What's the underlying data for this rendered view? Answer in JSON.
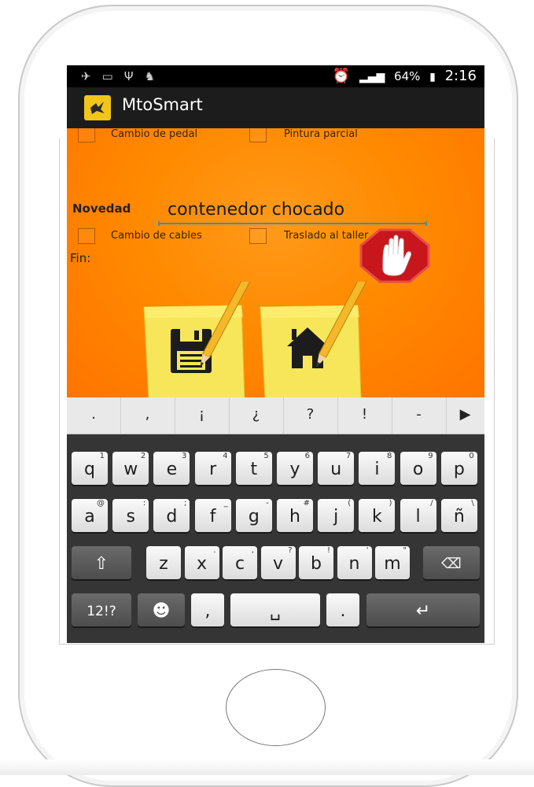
{
  "status_bar": {
    "battery_percent": "64%",
    "time": "2:16",
    "left_icons": [
      "satellite-icon",
      "keyboard-icon",
      "usb-icon",
      "android-icon"
    ],
    "right_icons": [
      "alarm-icon",
      "signal-icon",
      "battery-icon"
    ]
  },
  "app": {
    "title": "MtoSmart",
    "logo_icon": "bird-logo-icon",
    "logo_color": "#f2c51a"
  },
  "form": {
    "checkboxes": [
      {
        "label": "Cambio de pedal",
        "checked": false
      },
      {
        "label": "Pintura parcial",
        "checked": false
      },
      {
        "label": "Cambio de cables",
        "checked": false
      },
      {
        "label": "Traslado al taller",
        "checked": false
      }
    ],
    "novedad_label": "Novedad",
    "novedad_value": "contenedor chocado",
    "fin_label": "Fin:",
    "stop_icon": "stop-hand-icon",
    "save_icon": "save-floppy-icon",
    "home_icon": "home-icon",
    "background_color": "#ff8a00"
  },
  "keyboard": {
    "suggestions": [
      ".",
      ",",
      "¡",
      "¿",
      "?",
      "!",
      "-",
      "▶"
    ],
    "row1": [
      {
        "k": "q",
        "s": "1"
      },
      {
        "k": "w",
        "s": "2"
      },
      {
        "k": "e",
        "s": "3"
      },
      {
        "k": "r",
        "s": "4"
      },
      {
        "k": "t",
        "s": "5"
      },
      {
        "k": "y",
        "s": "6"
      },
      {
        "k": "u",
        "s": "7"
      },
      {
        "k": "i",
        "s": "8"
      },
      {
        "k": "o",
        "s": "9"
      },
      {
        "k": "p",
        "s": "0"
      }
    ],
    "row2": [
      {
        "k": "a",
        "s": "@"
      },
      {
        "k": "s",
        "s": ":"
      },
      {
        "k": "d",
        "s": ";"
      },
      {
        "k": "f",
        "s": "_"
      },
      {
        "k": "g",
        "s": "-"
      },
      {
        "k": "h",
        "s": "#"
      },
      {
        "k": "j",
        "s": "("
      },
      {
        "k": "k",
        "s": ")"
      },
      {
        "k": "l",
        "s": "/"
      },
      {
        "k": "ñ",
        "s": "\\"
      }
    ],
    "row3": [
      {
        "k": "z",
        "s": ""
      },
      {
        "k": "x",
        "s": "."
      },
      {
        "k": "c",
        "s": ","
      },
      {
        "k": "v",
        "s": "?"
      },
      {
        "k": "b",
        "s": "!"
      },
      {
        "k": "n",
        "s": "'"
      },
      {
        "k": "m",
        "s": "\""
      }
    ],
    "shift": "⇧",
    "backspace": "⌫",
    "symbols": "12!?",
    "emoji": "☻",
    "comma": ",",
    "space": "␣",
    "period": ".",
    "enter": "↵"
  }
}
